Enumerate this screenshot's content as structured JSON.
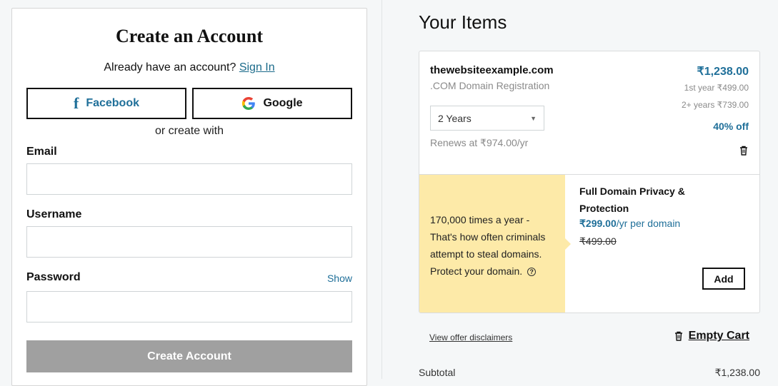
{
  "signup": {
    "title": "Create an Account",
    "already_text": "Already have an account?",
    "signin_label": "Sign In",
    "facebook_label": "Facebook",
    "google_label": "Google",
    "or_create": "or create with",
    "email_label": "Email",
    "email_value": "",
    "username_label": "Username",
    "username_value": "",
    "password_label": "Password",
    "password_value": "",
    "show_label": "Show",
    "submit_label": "Create Account"
  },
  "cart": {
    "title": "Your Items",
    "item": {
      "domain": "thewebsiteexample.com",
      "type": ".COM Domain Registration",
      "price": "₹1,238.00",
      "first_year": "1st year ₹499.00",
      "next_years": "2+ years ₹739.00",
      "discount": "40% off",
      "term_selected": "2 Years",
      "renews": "Renews at ₹974.00/yr"
    },
    "promo": {
      "text": "170,000 times a year - That's how often criminals attempt to steal domains. Protect your domain.",
      "addon_title": "Full Domain Privacy & Protection",
      "addon_price": "₹299.00",
      "addon_price_suffix": "/yr per domain",
      "addon_old_price": "₹499.00",
      "add_label": "Add"
    },
    "disclaimer_label": "View offer disclaimers",
    "empty_cart_label": "Empty Cart",
    "subtotal_label": "Subtotal",
    "subtotal_value": "₹1,238.00"
  },
  "colors": {
    "accent": "#1f6f99",
    "promo_bg": "#fdeaa8",
    "disabled_button": "#a0a0a0"
  },
  "icons": [
    "facebook-icon",
    "google-icon",
    "chevron-down-icon",
    "trash-icon",
    "question-icon"
  ]
}
